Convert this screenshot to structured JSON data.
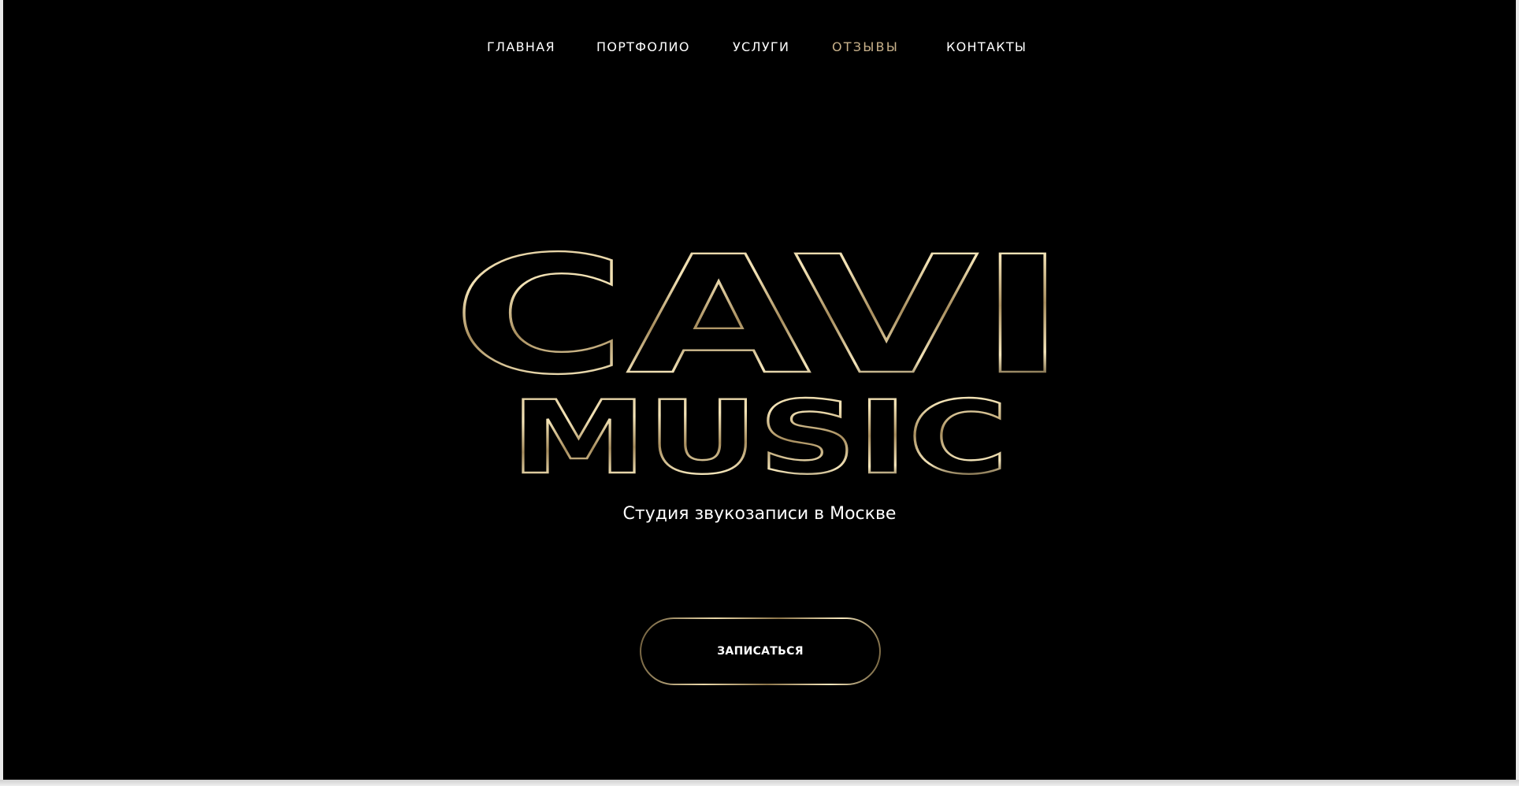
{
  "nav": {
    "items": [
      {
        "label": "ГЛАВНАЯ",
        "active": false
      },
      {
        "label": "ПОРТФОЛИО",
        "active": false
      },
      {
        "label": "УСЛУГИ",
        "active": false
      },
      {
        "label": "ОТЗЫВЫ",
        "active": true
      },
      {
        "label": "КОНТАКТЫ",
        "active": false
      }
    ]
  },
  "hero": {
    "logo_line1": "CAVI",
    "logo_line2": "MUSIC",
    "subtitle": "Студия звукозаписи в Москве",
    "cta_label": "ЗАПИСАТЬСЯ"
  },
  "colors": {
    "background": "#000000",
    "text": "#ffffff",
    "accent_gold": "#c9b28b"
  }
}
